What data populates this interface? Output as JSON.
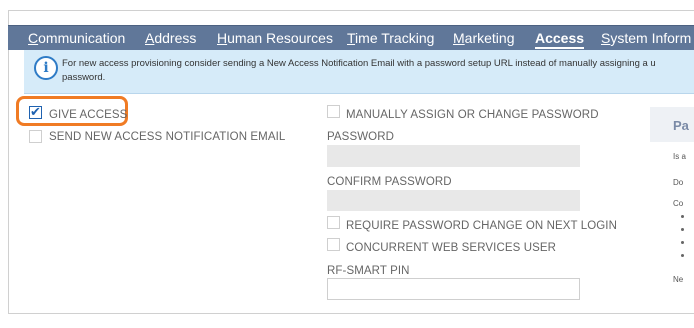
{
  "tabs": [
    {
      "pre": "",
      "u": "C",
      "post": "ommunication",
      "active": false
    },
    {
      "pre": "",
      "u": "A",
      "post": "ddress",
      "active": false
    },
    {
      "pre": "",
      "u": "H",
      "post": "uman Resources",
      "active": false
    },
    {
      "pre": "",
      "u": "T",
      "post": "ime Tracking",
      "active": false
    },
    {
      "pre": "",
      "u": "M",
      "post": "arketing",
      "active": false
    },
    {
      "pre": "",
      "u": "",
      "post": "Access",
      "active": true
    },
    {
      "pre": "",
      "u": "S",
      "post": "ystem Inform",
      "active": false
    }
  ],
  "info": {
    "line1": "For new access provisioning consider sending a New Access Notification Email with a password setup URL instead of manually assigning a u",
    "line2": "password."
  },
  "left": {
    "give_access": {
      "label": "GIVE ACCESS",
      "checked": true
    },
    "send_email": {
      "label": "SEND NEW ACCESS NOTIFICATION EMAIL",
      "checked": false
    }
  },
  "middle": {
    "manual_password": {
      "label": "MANUALLY ASSIGN OR CHANGE PASSWORD",
      "checked": false
    },
    "password_label": "PASSWORD",
    "confirm_label": "CONFIRM PASSWORD",
    "require_change": {
      "label": "REQUIRE PASSWORD CHANGE ON NEXT LOGIN",
      "checked": false
    },
    "concurrent": {
      "label": "CONCURRENT WEB SERVICES USER",
      "checked": false
    },
    "rf_pin_label": "RF-SMART PIN"
  },
  "right_panel": {
    "title": "Pa",
    "lines": [
      "Is a",
      "Do",
      "Co",
      "Ne"
    ]
  },
  "colors": {
    "tab_bar": "#607799",
    "info_bg": "#d6ebf9",
    "highlight": "#f07b24",
    "check": "#1f62b0"
  },
  "icons": [
    "info-icon",
    "checkmark-icon"
  ]
}
